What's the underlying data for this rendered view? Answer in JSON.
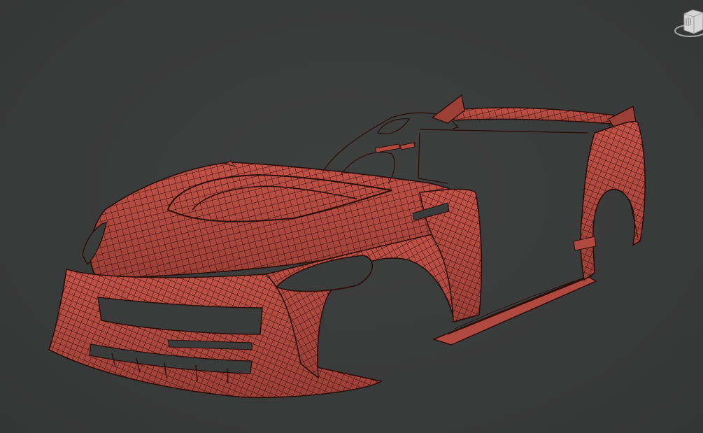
{
  "viewport": {
    "background": "#3a3b3b",
    "mesh_fill": "#b04a40",
    "mesh_fill_dark": "#8e3a33",
    "mesh_wire": "#2a0c09",
    "mesh_wire_light": "#3b120e"
  },
  "viewcube": {
    "face_label": "",
    "icon": "viewcube-icon"
  }
}
